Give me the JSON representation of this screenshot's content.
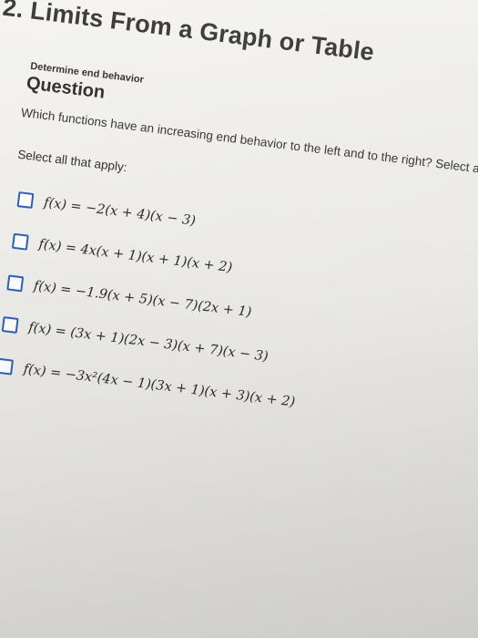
{
  "header": {
    "title": "2. Limits From a Graph or Table"
  },
  "question": {
    "category": "Determine end behavior",
    "title": "Question",
    "text": "Which functions have an increasing end behavior to the left and to the right? Select all that apply.",
    "instruction": "Select all that apply:"
  },
  "options": [
    {
      "label": "f(x) = −2(x + 4)(x − 3)",
      "checked": false
    },
    {
      "label": "f(x) = 4x(x + 1)(x + 1)(x + 2)",
      "checked": false
    },
    {
      "label": "f(x) = −1.9(x + 5)(x − 7)(2x + 1)",
      "checked": false
    },
    {
      "label": "f(x) = (3x + 1)(2x − 3)(x + 7)(x − 3)",
      "checked": false
    },
    {
      "label": "f(x) = −3x²(4x − 1)(3x + 1)(x + 3)(x + 2)",
      "checked": false
    }
  ],
  "colors": {
    "checkbox_border": "#2e5fb7",
    "text": "#2a2a2a"
  }
}
